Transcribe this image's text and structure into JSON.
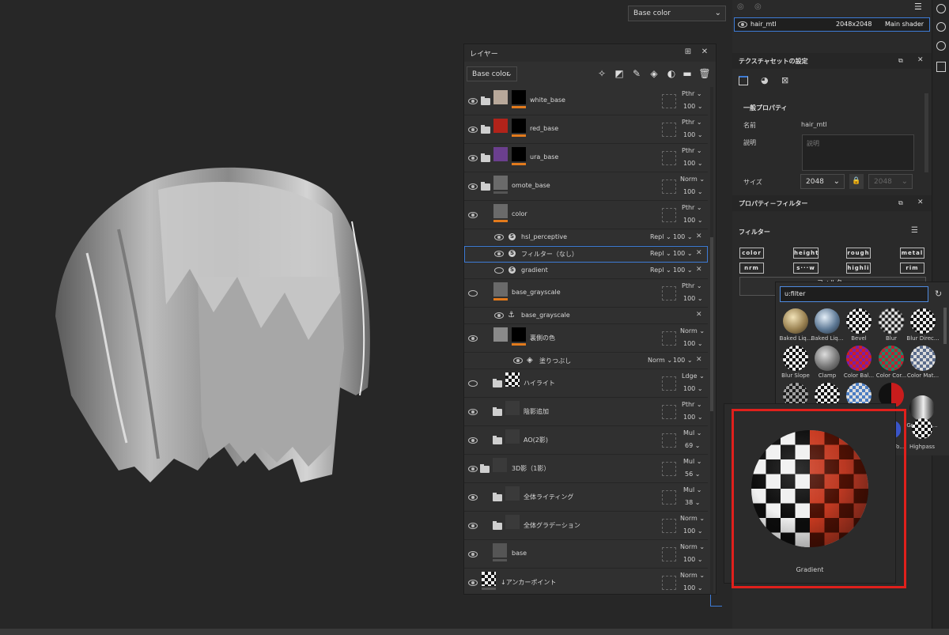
{
  "viewport": {
    "channel_select": "Base color"
  },
  "layer_panel": {
    "title": "レイヤー",
    "channel_select": "Base color",
    "layers": [
      {
        "name": "white_base",
        "blend": "Pthr",
        "opacity": "100",
        "eye": false
      },
      {
        "name": "red_base",
        "blend": "Pthr",
        "opacity": "100",
        "eye": false
      },
      {
        "name": "ura_base",
        "blend": "Pthr",
        "opacity": "100",
        "eye": false
      },
      {
        "name": "omote_base",
        "blend": "Norm",
        "opacity": "100",
        "eye": true
      },
      {
        "name": "color",
        "blend": "Pthr",
        "opacity": "100",
        "eye": true
      },
      {
        "name": "hsl_perceptive",
        "blend": "Repl",
        "opacity": "100",
        "eye": true
      },
      {
        "name": "フィルター（なし）",
        "blend": "Repl",
        "opacity": "100",
        "eye": true
      },
      {
        "name": "gradient",
        "blend": "Repl",
        "opacity": "100",
        "eye": false
      },
      {
        "name": "base_grayscale",
        "blend": "Pthr",
        "opacity": "100",
        "eye": false
      },
      {
        "name": "base_grayscale",
        "blend": "",
        "opacity": "",
        "eye": true
      },
      {
        "name": "裏側の色",
        "blend": "Norm",
        "opacity": "100",
        "eye": true
      },
      {
        "name": "塗りつぶし",
        "blend": "Norm",
        "opacity": "100",
        "eye": true
      },
      {
        "name": "ハイライト",
        "blend": "Ldge",
        "opacity": "100",
        "eye": false
      },
      {
        "name": "陰影追加",
        "blend": "Pthr",
        "opacity": "100",
        "eye": true
      },
      {
        "name": "AO(2影)",
        "blend": "Mul",
        "opacity": "69",
        "eye": true
      },
      {
        "name": "3D影（1影）",
        "blend": "Mul",
        "opacity": "56",
        "eye": true
      },
      {
        "name": "全体ライティング",
        "blend": "Mul",
        "opacity": "38",
        "eye": true
      },
      {
        "name": "全体グラデーション",
        "blend": "Norm",
        "opacity": "100",
        "eye": true
      },
      {
        "name": "base",
        "blend": "Norm",
        "opacity": "100",
        "eye": true
      },
      {
        "name": "↓アンカーポイント",
        "blend": "Norm",
        "opacity": "100",
        "eye": true
      }
    ]
  },
  "right_panel": {
    "texture_set": {
      "name": "hair_mtl",
      "size": "2048x2048",
      "shader": "Main shader"
    },
    "settings_title": "テクスチャセットの設定",
    "general_props": "一般プロパティ",
    "name_label": "名前",
    "name_value": "hair_mtl",
    "desc_label": "説明",
    "desc_placeholder": "説明",
    "size_label": "サイズ",
    "size_value": "2048",
    "size_value2": "2048",
    "props_filter_title": "プロパティ－フィルター",
    "filter_label": "フィルター",
    "channel_buttons": [
      "color",
      "height",
      "rough",
      "metal",
      "nrm",
      "s···w",
      "highli",
      "rim"
    ],
    "filter_btn_partial": "フィルター"
  },
  "filter_popup": {
    "query": "u:filter",
    "tiles": [
      "Baked Liq...",
      "Baked Liq...",
      "Bevel",
      "Blur",
      "Blur Direc...",
      "Blur Slope",
      "Clamp",
      "Color Bal...",
      "Color Cor...",
      "Color Mat...",
      "",
      "",
      "",
      "",
      "Gradient ..."
    ],
    "partial_tiles": [
      "To...",
      "Highpass"
    ]
  },
  "preview": {
    "label": "Gradient"
  },
  "colors": {
    "accent": "#3d7bd6",
    "highlight": "#e0201c",
    "orange": "#e27a1c"
  }
}
